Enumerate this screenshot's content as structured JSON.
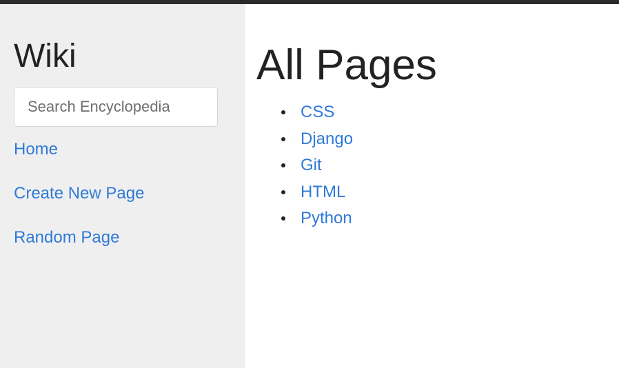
{
  "sidebar": {
    "brand": "Wiki",
    "search_placeholder": "Search Encyclopedia",
    "links": [
      "Home",
      "Create New Page",
      "Random Page"
    ]
  },
  "main": {
    "title": "All Pages",
    "pages": [
      "CSS",
      "Django",
      "Git",
      "HTML",
      "Python"
    ]
  },
  "colors": {
    "link": "#2f7ad8",
    "sidebar_bg": "#efefef",
    "text": "#222222"
  }
}
